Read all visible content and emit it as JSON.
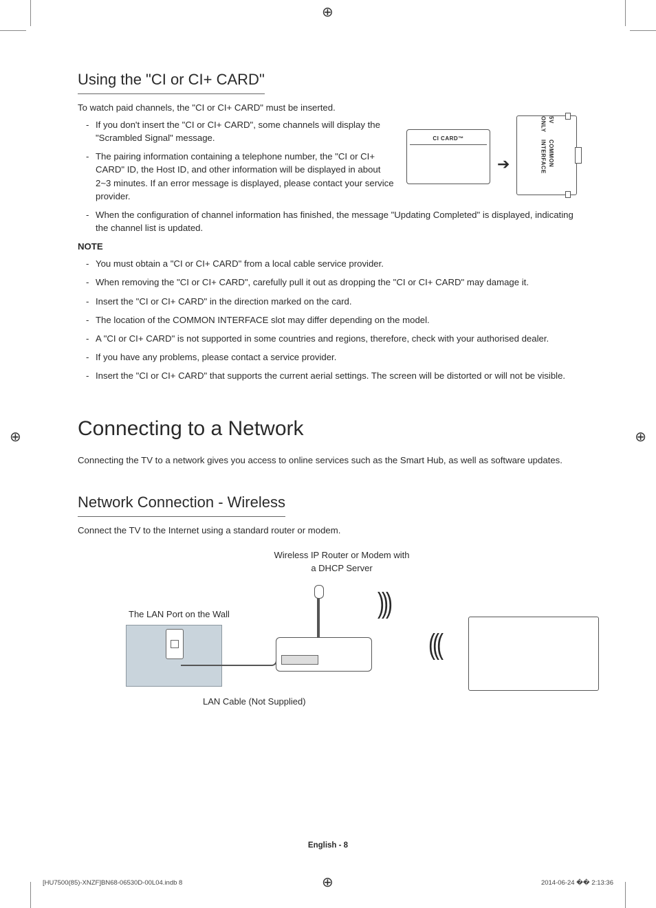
{
  "ci": {
    "title": "Using the \"CI or CI+ CARD\"",
    "intro": "To watch paid channels, the \"CI or CI+ CARD\" must be inserted.",
    "bullets_top": [
      "If you don't insert the \"CI or CI+ CARD\", some channels will display the \"Scrambled Signal\" message.",
      "The pairing information containing a telephone number, the \"CI or CI+ CARD\" ID, the Host ID, and other information will be displayed in about 2~3 minutes. If an error message is displayed, please contact your service provider."
    ],
    "bullets_full": [
      "When the configuration of channel information has finished, the message \"Updating Completed\" is displayed, indicating the channel list is updated."
    ],
    "note_label": "NOTE",
    "notes": [
      "You must obtain a \"CI or CI+ CARD\" from a local cable service provider.",
      "When removing the \"CI or CI+ CARD\", carefully pull it out as dropping the \"CI or CI+ CARD\" may damage it.",
      "Insert the \"CI or CI+ CARD\" in the direction marked on the card.",
      "The location of the COMMON INTERFACE slot may differ depending on the model.",
      "A \"CI or CI+ CARD\" is not supported in some countries and regions, therefore, check with your authorised dealer.",
      "If you have any problems, please contact a service provider.",
      "Insert the \"CI or CI+ CARD\" that supports the current aerial settings. The screen will be distorted or will not be visible."
    ],
    "diagram": {
      "card_label": "CI CARD™",
      "slot_label_1": "5V ONLY",
      "slot_label_2": "COMMON INTERFACE"
    }
  },
  "network": {
    "heading": "Connecting to a Network",
    "intro": "Connecting the TV to a network gives you access to online services such as the Smart Hub, as well as software updates.",
    "wireless_title": "Network Connection - Wireless",
    "wireless_intro": "Connect the TV to the Internet using a standard router or modem.",
    "diagram": {
      "router_label_1": "Wireless IP Router or Modem with",
      "router_label_2": "a DHCP Server",
      "wall_label": "The LAN Port on the Wall",
      "cable_label": "LAN Cable (Not Supplied)"
    }
  },
  "footer": {
    "page": "English - 8",
    "indd": "[HU7500(85)-XNZF]BN68-06530D-00L04.indb   8",
    "timestamp": "2014-06-24   �� 2:13:36"
  }
}
